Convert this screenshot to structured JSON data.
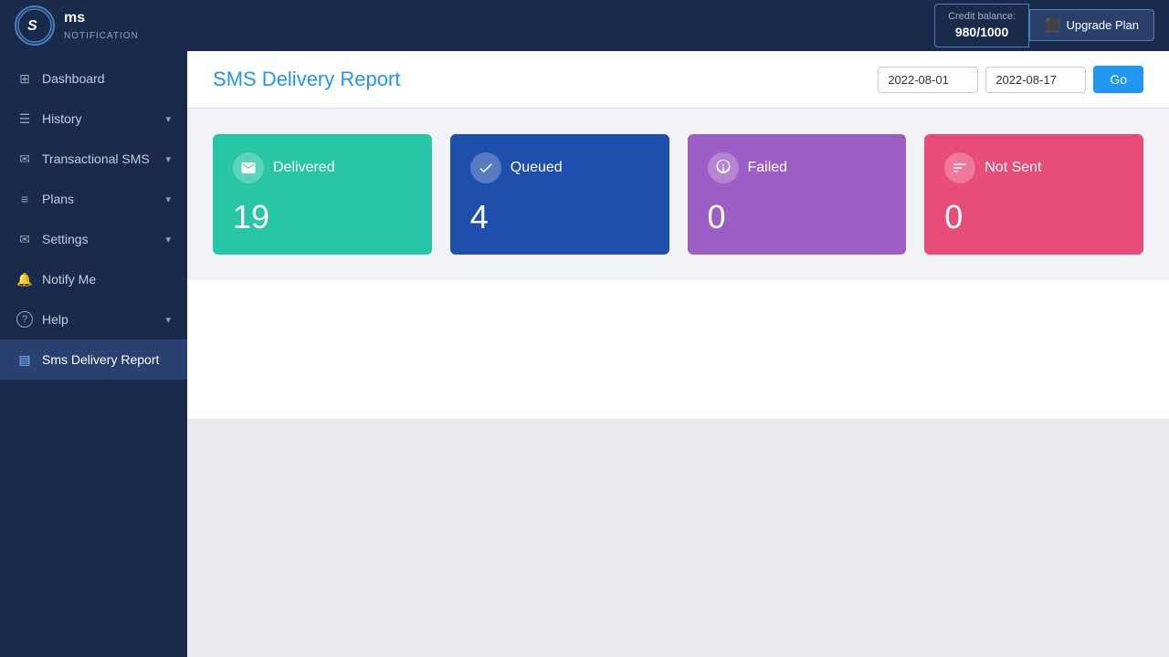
{
  "topbar": {
    "logo_letter": "S",
    "logo_name": "ms",
    "logo_subtitle": "NOTIFICATION",
    "credit_label": "Credit balance:",
    "credit_amount": "980/1000",
    "upgrade_label": "Upgrade Plan"
  },
  "sidebar": {
    "items": [
      {
        "id": "dashboard",
        "label": "Dashboard",
        "icon": "⊞",
        "has_arrow": false,
        "active": false
      },
      {
        "id": "history",
        "label": "History",
        "icon": "☰",
        "has_arrow": true,
        "active": false
      },
      {
        "id": "transactional-sms",
        "label": "Transactional SMS",
        "icon": "✉",
        "has_arrow": true,
        "active": false
      },
      {
        "id": "plans",
        "label": "Plans",
        "icon": "≡",
        "has_arrow": true,
        "active": false
      },
      {
        "id": "settings",
        "label": "Settings",
        "icon": "✉",
        "has_arrow": true,
        "active": false
      },
      {
        "id": "notify-me",
        "label": "Notify Me",
        "icon": "🔔",
        "has_arrow": false,
        "active": false
      },
      {
        "id": "help",
        "label": "Help",
        "icon": "?",
        "has_arrow": true,
        "active": false
      },
      {
        "id": "sms-delivery-report",
        "label": "Sms Delivery Report",
        "icon": "▤",
        "has_arrow": false,
        "active": true
      }
    ]
  },
  "header": {
    "title_prefix": "S",
    "title_rest": "MS Delivery Report",
    "date_from": "2022-08-01",
    "date_to": "2022-08-17",
    "go_label": "Go"
  },
  "stats": {
    "cards": [
      {
        "id": "delivered",
        "label": "Delivered",
        "value": "19",
        "icon": "✉",
        "color_class": "card-delivered"
      },
      {
        "id": "queued",
        "label": "Queued",
        "value": "4",
        "icon": "✔",
        "color_class": "card-queued"
      },
      {
        "id": "failed",
        "label": "Failed",
        "value": "0",
        "icon": "🛒",
        "color_class": "card-failed"
      },
      {
        "id": "not-sent",
        "label": "Not Sent",
        "value": "0",
        "icon": "🛒",
        "color_class": "card-not-sent"
      }
    ]
  }
}
